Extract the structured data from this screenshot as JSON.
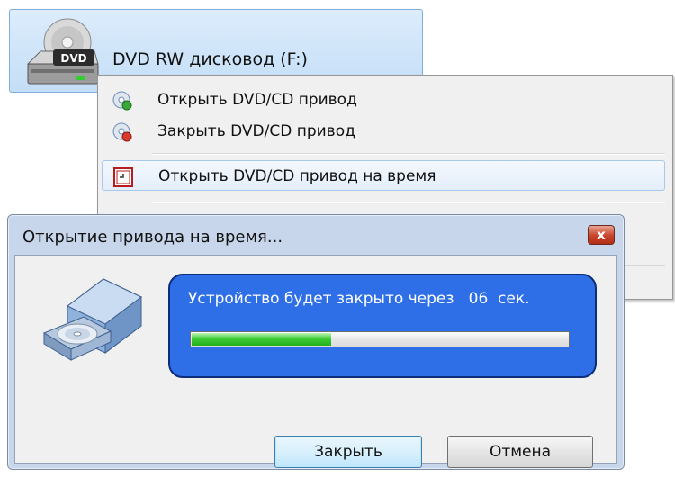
{
  "drive": {
    "label": "DVD RW дисковод (F:)",
    "icon": "dvd-drive-icon",
    "badge": "DVD"
  },
  "context_menu": {
    "items": [
      {
        "label": "Открыть DVD/CD привод",
        "icon": "disc-eject-icon"
      },
      {
        "label": "Закрыть DVD/CD привод",
        "icon": "disc-close-icon"
      },
      {
        "label": "Открыть DVD/CD привод на время",
        "icon": "timer-icon"
      }
    ]
  },
  "dialog": {
    "title": "Открытие привода на время...",
    "message": "Устройство будет закрыто через   06  сек.",
    "progress": 0.37,
    "close_glyph": "x",
    "buttons": {
      "close_label": "Закрыть",
      "cancel_label": "Отмена"
    },
    "icon": "dvd-drive-3d-icon"
  },
  "colors": {
    "selection_bg": "#c4def7",
    "panel_blue": "#2e6ee6",
    "progress_green": "#22b01a",
    "close_red": "#c7432a"
  }
}
